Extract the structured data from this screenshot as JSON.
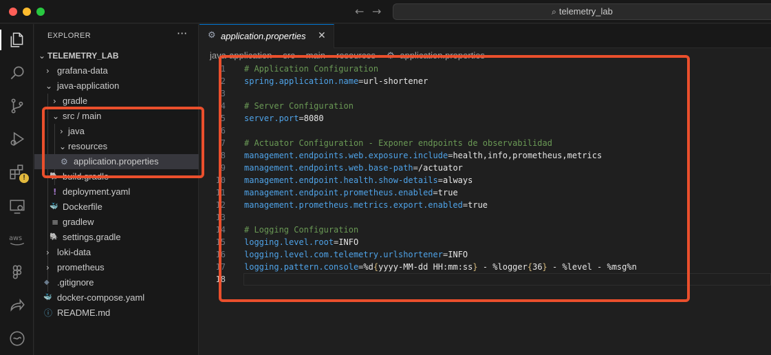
{
  "titlebar": {
    "search_text": "telemetry_lab",
    "icons": {
      "back": "arrow-left-icon",
      "forward": "arrow-right-icon",
      "search": "search-icon"
    }
  },
  "activity_bar": {
    "items": [
      "explorer-icon",
      "search-icon",
      "source-control-icon",
      "run-debug-icon",
      "extensions-icon",
      "remote-explorer-icon",
      "aws-icon",
      "figma-icon",
      "live-share-icon",
      "extra-icon"
    ],
    "warning_badge": "!"
  },
  "sidebar": {
    "title": "EXPLORER",
    "more": "···",
    "tree": [
      {
        "label": "TELEMETRY_LAB",
        "chevron": "v"
      },
      {
        "label": "grafana-data",
        "chevron": ">"
      },
      {
        "label": "java-application",
        "chevron": "v"
      },
      {
        "label": "gradle",
        "chevron": ">"
      },
      {
        "label": "src / main",
        "chevron": "v"
      },
      {
        "label": "java",
        "chevron": ">"
      },
      {
        "label": "resources",
        "chevron": "v"
      },
      {
        "label": "application.properties",
        "icon": "⚙"
      },
      {
        "label": "build.gradle",
        "icon": "🐘"
      },
      {
        "label": "deployment.yaml",
        "icon": "!"
      },
      {
        "label": "Dockerfile",
        "icon": "🐳"
      },
      {
        "label": "gradlew",
        "icon": "≡"
      },
      {
        "label": "settings.gradle",
        "icon": "🐘"
      },
      {
        "label": "loki-data",
        "chevron": ">"
      },
      {
        "label": "prometheus",
        "chevron": ">"
      },
      {
        "label": ".gitignore",
        "icon": "◆"
      },
      {
        "label": "docker-compose.yaml",
        "icon": "🐳"
      },
      {
        "label": "README.md",
        "icon": "ⓘ"
      }
    ]
  },
  "tab": {
    "label": "application.properties",
    "icon": "⚙",
    "close": "✕"
  },
  "breadcrumb": [
    "java-application",
    "src",
    "main",
    "resources",
    "application.properties"
  ],
  "code": [
    {
      "n": "1",
      "comment": "# Application Configuration"
    },
    {
      "n": "2",
      "key": "spring.application.name",
      "val": "url-shortener"
    },
    {
      "n": "3"
    },
    {
      "n": "4",
      "comment": "# Server Configuration"
    },
    {
      "n": "5",
      "key": "server.port",
      "val": "8080"
    },
    {
      "n": "6"
    },
    {
      "n": "7",
      "comment": "# Actuator Configuration - Exponer endpoints de observabilidad"
    },
    {
      "n": "8",
      "key": "management.endpoints.web.exposure.include",
      "val": "health,info,prometheus,metrics"
    },
    {
      "n": "9",
      "key": "management.endpoints.web.base-path",
      "val": "/actuator"
    },
    {
      "n": "10",
      "key": "management.endpoint.health.show-details",
      "val": "always"
    },
    {
      "n": "11",
      "key": "management.endpoint.prometheus.enabled",
      "val": "true"
    },
    {
      "n": "12",
      "key": "management.prometheus.metrics.export.enabled",
      "val": "true"
    },
    {
      "n": "13"
    },
    {
      "n": "14",
      "comment": "# Logging Configuration"
    },
    {
      "n": "15",
      "key": "logging.level.root",
      "val": "INFO"
    },
    {
      "n": "16",
      "key": "logging.level.com.telemetry.urlshortener",
      "val": "INFO"
    },
    {
      "n": "17",
      "key": "logging.pattern.console",
      "val1": "%d",
      "b1": "{",
      "val2": "yyyy-MM-dd HH:mm:ss",
      "b2": "}",
      "val3": " - %logger",
      "b3": "{",
      "val4": "36",
      "b4": "}",
      "val5": " - %level - %msg%n"
    },
    {
      "n": "18"
    }
  ],
  "colors": {
    "highlight": "#ea4f2c",
    "comment": "#6a9955",
    "key": "#4fa3e8",
    "brace": "#d7ba7d"
  }
}
